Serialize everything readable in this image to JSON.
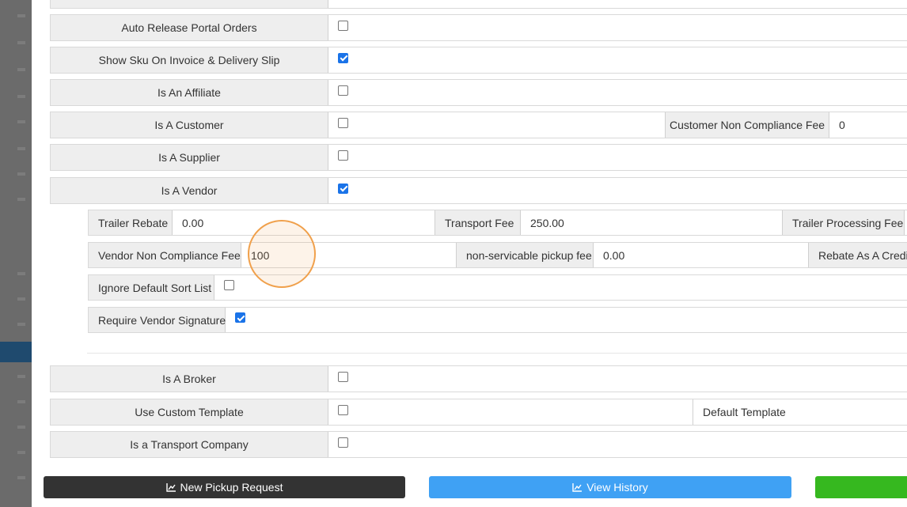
{
  "rows": {
    "auto_release_portal_orders": {
      "label": "Auto Release Portal Orders",
      "checked": false
    },
    "show_sku": {
      "label": "Show Sku On Invoice & Delivery Slip",
      "checked": true
    },
    "is_affiliate": {
      "label": "Is An Affiliate",
      "checked": false
    },
    "is_customer": {
      "label": "Is A Customer",
      "checked": false,
      "fee_label": "Customer Non Compliance Fee",
      "fee_value": "0"
    },
    "is_supplier": {
      "label": "Is A Supplier",
      "checked": false
    },
    "is_vendor": {
      "label": "Is A Vendor",
      "checked": true
    },
    "is_broker": {
      "label": "Is A Broker",
      "checked": false
    },
    "use_custom_template": {
      "label": "Use Custom Template",
      "checked": false,
      "template_label": "Default Template"
    },
    "is_transport_company": {
      "label": "Is a Transport Company",
      "checked": false
    }
  },
  "vendor": {
    "trailer_rebate_label": "Trailer Rebate",
    "trailer_rebate_value": "0.00",
    "transport_fee_label": "Transport Fee",
    "transport_fee_value": "250.00",
    "trailer_processing_fee_label": "Trailer Processing Fee",
    "vendor_non_compliance_fee_label": "Vendor Non Compliance Fee",
    "vendor_non_compliance_fee_value": "100",
    "non_servicable_pickup_fee_label": "non-servicable pickup fee",
    "non_servicable_pickup_fee_value": "0.00",
    "rebate_as_credit_label": "Rebate As A Credit",
    "ignore_default_sort_list_label": "Ignore Default Sort List",
    "ignore_default_sort_list_checked": false,
    "require_vendor_signature_label": "Require Vendor Signature",
    "require_vendor_signature_checked": true
  },
  "footer": {
    "new_pickup_request_label": "New Pickup Request",
    "view_history_label": "View History",
    "icon": "line-chart-icon"
  },
  "colors": {
    "label_bg": "#eeeeee",
    "checkbox_checked": "#1a73e8",
    "btn_dark": "#333333",
    "btn_blue": "#3fa1f4",
    "btn_green": "#36b81f",
    "focus_ring": "#f0a04b"
  }
}
